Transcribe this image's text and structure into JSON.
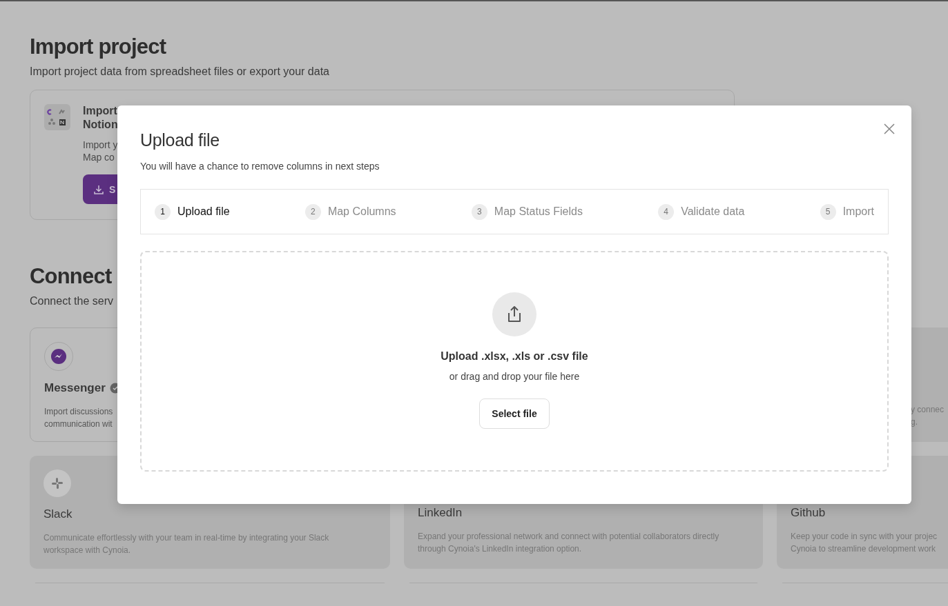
{
  "page": {
    "title": "Import project",
    "subtitle": "Import project data from spreadsheet files or export your data"
  },
  "import_card": {
    "title_lines": [
      "Import",
      "Notion"
    ],
    "description_lines": [
      "Import y",
      "Map co"
    ],
    "button": "S"
  },
  "connect": {
    "title": "Connect",
    "subtitle": "Connect the serv"
  },
  "integrations": [
    {
      "kind": "messenger",
      "name": "Messenger",
      "verified": true,
      "description_lines": [
        "Import discussions",
        "communication wit"
      ]
    },
    {
      "kind": "partial",
      "description_lines": [
        "y connec",
        "g."
      ]
    },
    {
      "kind": "slack",
      "name": "Slack",
      "description_lines": [
        "Communicate effortlessly with your team in real-time by integrating your Slack",
        "workspace with Cynoia."
      ]
    },
    {
      "kind": "hidden-icon",
      "name": "LinkedIn",
      "description_lines": [
        "Expand your professional network and connect with potential collaborators directly",
        "through Cynoia's LinkedIn integration option."
      ]
    },
    {
      "kind": "hidden-icon",
      "name": "Github",
      "description_lines": [
        "Keep your code in sync with your projec",
        "Cynoia to streamline development work"
      ]
    }
  ],
  "modal": {
    "title": "Upload file",
    "subtitle": "You will have a chance to remove columns in next steps",
    "steps": [
      {
        "number": "1",
        "label": "Upload file",
        "selected": true
      },
      {
        "number": "2",
        "label": "Map Columns",
        "selected": false
      },
      {
        "number": "3",
        "label": "Map Status Fields",
        "selected": false
      },
      {
        "number": "4",
        "label": "Validate data",
        "selected": false
      },
      {
        "number": "5",
        "label": "Import",
        "selected": false
      }
    ],
    "dropzone": {
      "title": "Upload .xlsx, .xls or .csv file",
      "hint": "or drag and drop your file here",
      "button": "Select file"
    }
  }
}
